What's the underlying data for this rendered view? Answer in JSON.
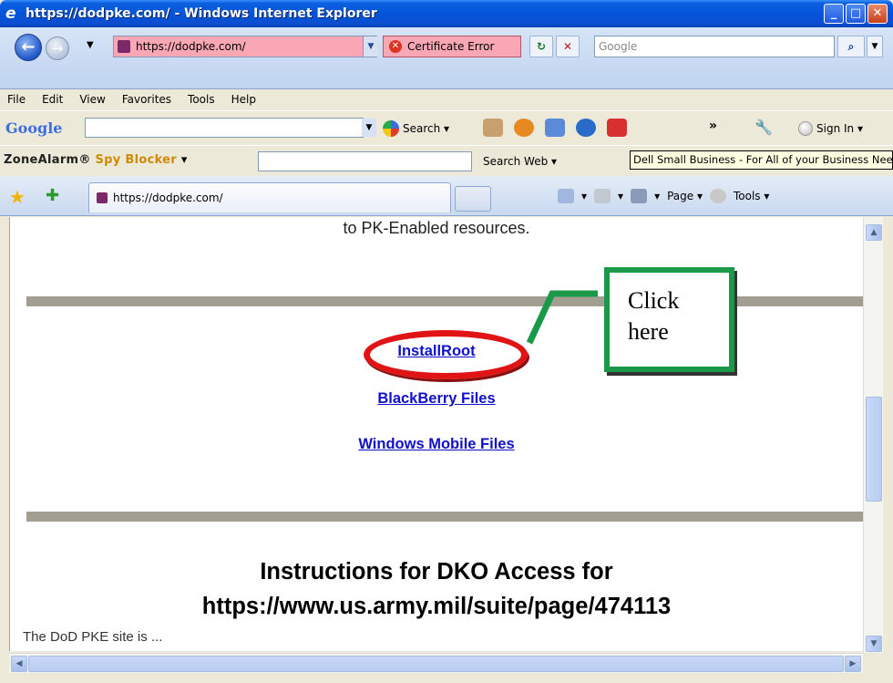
{
  "window": {
    "title": "https://dodpke.com/ - Windows Internet Explorer",
    "buttons": {
      "minimize": "_",
      "maximize": "□",
      "close": "✕"
    }
  },
  "address_bar": {
    "url": "https://dodpke.com/",
    "certificate_error": "Certificate Error",
    "search_placeholder": "Google"
  },
  "menu": [
    "File",
    "Edit",
    "View",
    "Favorites",
    "Tools",
    "Help"
  ],
  "google_toolbar": {
    "logo": "Google",
    "search_label": "Search ▾",
    "more": "»",
    "sign_in": "Sign In ▾"
  },
  "zonealarm": {
    "logo_prefix": "ZoneAlarm®",
    "logo_suffix": "Spy Blocker",
    "search_web": "Search Web ▾"
  },
  "tooltip": "Dell Small Business - For All of your Business Needs",
  "tabs": {
    "active_label": "https://dodpke.com/",
    "page_menu": "Page ▾",
    "tools_menu": "Tools ▾"
  },
  "page": {
    "top_text": "to PK-Enabled resources.",
    "links": [
      "InstallRoot",
      "BlackBerry Files",
      "Windows Mobile Files"
    ],
    "instructions_line1": "Instructions for DKO Access for",
    "instructions_line2": "https://www.us.army.mil/suite/page/474113",
    "cut_text": "The DoD PKE site is...(cut off)"
  },
  "callout": {
    "line1": "Click",
    "line2": "here"
  },
  "colors": {
    "link": "#1010cc",
    "callout_border": "#1a9a48",
    "highlight": "#e01414",
    "divider": "#a29f92",
    "titlebar": "#0553d8"
  }
}
